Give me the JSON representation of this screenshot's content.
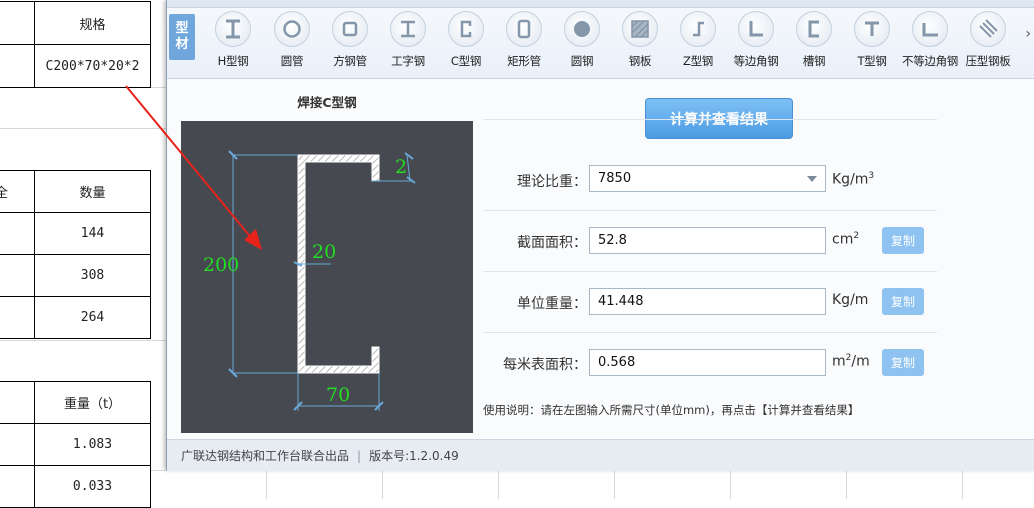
{
  "sheet": {
    "spec_header": "规格",
    "spec_value": "C200*70*20*2",
    "partial_header": "全",
    "qty_header": "数量",
    "quantities": [
      "144",
      "308",
      "264"
    ],
    "weight_header": "重量（t）",
    "weights": [
      "1.083",
      "0.033"
    ]
  },
  "toolbar": {
    "side_tab": [
      "型",
      "材"
    ],
    "tools": [
      {
        "label": "H型钢",
        "icon": "h-beam-icon"
      },
      {
        "label": "圆管",
        "icon": "round-tube-icon"
      },
      {
        "label": "方钢管",
        "icon": "square-tube-icon"
      },
      {
        "label": "工字钢",
        "icon": "i-beam-icon"
      },
      {
        "label": "C型钢",
        "icon": "c-channel-icon"
      },
      {
        "label": "矩形管",
        "icon": "rect-tube-icon"
      },
      {
        "label": "圆钢",
        "icon": "round-bar-icon"
      },
      {
        "label": "钢板",
        "icon": "steel-plate-icon"
      },
      {
        "label": "Z型钢",
        "icon": "z-section-icon"
      },
      {
        "label": "等边角钢",
        "icon": "equal-angle-icon"
      },
      {
        "label": "槽钢",
        "icon": "channel-icon"
      },
      {
        "label": "T型钢",
        "icon": "t-section-icon"
      },
      {
        "label": "不等边角钢",
        "icon": "unequal-angle-icon"
      },
      {
        "label": "压型钢板",
        "icon": "profiled-sheet-icon"
      }
    ]
  },
  "diagram": {
    "title": "焊接C型钢",
    "height": "200",
    "lip": "20",
    "thickness": "2",
    "width": "70"
  },
  "calc_button": "计算并查看结果",
  "rows": {
    "density": {
      "label": "理论比重：",
      "value": "7850",
      "unit": "Kg/m",
      "unit_sup": "3"
    },
    "area": {
      "label": "截面面积：",
      "value": "52.8",
      "unit": "cm",
      "unit_sup": "2",
      "copy": "复制"
    },
    "unit_weight": {
      "label": "单位重量：",
      "value": "41.448",
      "unit": "Kg/m",
      "copy": "复制"
    },
    "surface": {
      "label": "每米表面积：",
      "value": "0.568",
      "unit_pre": "m",
      "unit_sup": "2",
      "unit_post": "/m",
      "copy": "复制"
    }
  },
  "usage": "使用说明：请在左图输入所需尺寸(单位mm)，再点击【计算并查看结果】",
  "footer": {
    "credit": "广联达钢结构和工作台联合出品",
    "version": "版本号:1.2.0.49"
  },
  "colors": {
    "diagram_bg": "#464950",
    "dimension_text": "#22dd22",
    "annotation_arrow": "#e8231a",
    "calc_button": "#5aa8ea"
  }
}
